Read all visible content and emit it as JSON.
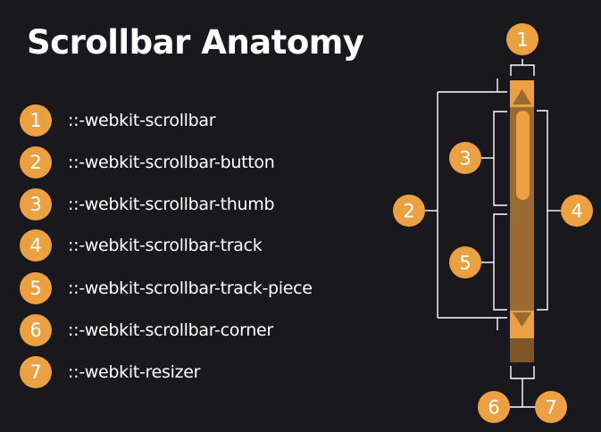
{
  "title": "Scrollbar Anatomy",
  "legend": [
    {
      "number": "1",
      "label": "::-webkit-scrollbar"
    },
    {
      "number": "2",
      "label": "::-webkit-scrollbar-button"
    },
    {
      "number": "3",
      "label": "::-webkit-scrollbar-thumb"
    },
    {
      "number": "4",
      "label": "::-webkit-scrollbar-track"
    },
    {
      "number": "5",
      "label": "::-webkit-scrollbar-track-piece"
    },
    {
      "number": "6",
      "label": "::-webkit-scrollbar-corner"
    },
    {
      "number": "7",
      "label": "::-webkit-resizer"
    }
  ],
  "callouts": {
    "c1": "1",
    "c2": "2",
    "c3": "3",
    "c4": "4",
    "c5": "5",
    "c6": "6",
    "c7": "7"
  },
  "colors": {
    "background": "#19191d",
    "accent": "#eba141",
    "track": "#9a6a30",
    "corner": "#7d5526",
    "line": "#ffffff"
  }
}
